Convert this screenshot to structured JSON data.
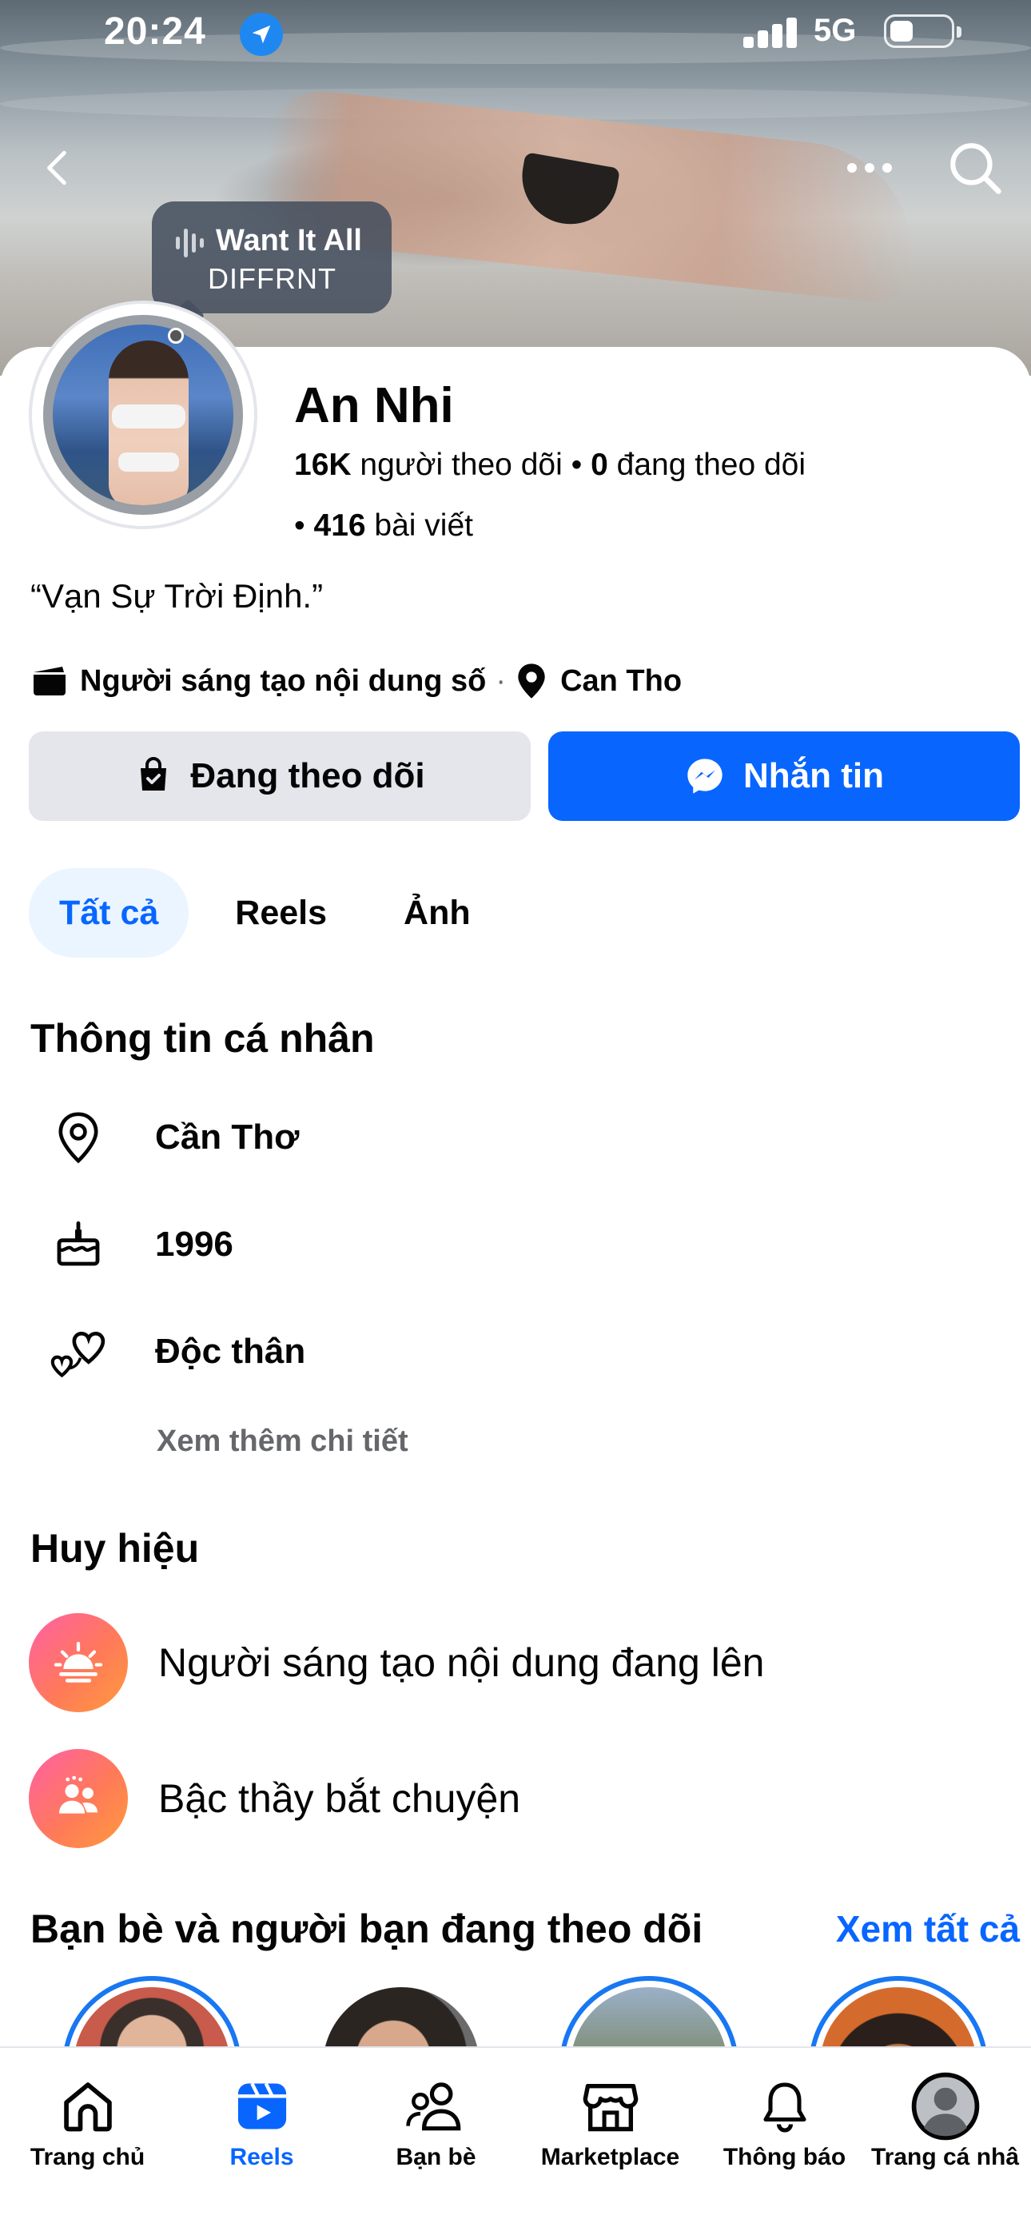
{
  "status_bar": {
    "time": "20:24",
    "network": "5G"
  },
  "music": {
    "title": "Want It All",
    "artist": "DIFFRNT"
  },
  "profile": {
    "name": "An Nhi",
    "followers_count": "16K",
    "followers_label": "người theo dõi",
    "following_count": "0",
    "following_label": "đang theo dõi",
    "posts_count": "416",
    "posts_label": "bài viết",
    "bio": "“Vạn Sự Trời Định.”",
    "category": "Người sáng tạo nội dung số",
    "location": "Can Tho"
  },
  "actions": {
    "follow_label": "Đang theo dõi",
    "message_label": "Nhắn tin"
  },
  "tabs": [
    {
      "label": "Tất cả",
      "active": true
    },
    {
      "label": "Reels",
      "active": false
    },
    {
      "label": "Ảnh",
      "active": false
    }
  ],
  "personal_info": {
    "title": "Thông tin cá nhân",
    "items": [
      {
        "icon": "location-pin-icon",
        "text": "Cần Thơ"
      },
      {
        "icon": "birthday-cake-icon",
        "text": "1996"
      },
      {
        "icon": "relationship-hearts-icon",
        "text": "Độc thân"
      }
    ],
    "see_more": "Xem thêm chi tiết"
  },
  "badges": {
    "title": "Huy hiệu",
    "items": [
      {
        "icon": "rising-sun-icon",
        "text": "Người sáng tạo nội dung đang lên"
      },
      {
        "icon": "people-group-icon",
        "text": "Bậc thầy bắt chuyện"
      }
    ]
  },
  "friends": {
    "title": "Bạn bè và người bạn đang theo dõi",
    "see_all": "Xem tất cả"
  },
  "bottom_nav": [
    {
      "label": "Trang chủ",
      "icon": "home-icon",
      "active": false
    },
    {
      "label": "Reels",
      "icon": "reels-icon",
      "active": true
    },
    {
      "label": "Bạn bè",
      "icon": "friends-icon",
      "active": false
    },
    {
      "label": "Marketplace",
      "icon": "marketplace-icon",
      "active": false
    },
    {
      "label": "Thông báo",
      "icon": "bell-icon",
      "active": false
    },
    {
      "label": "Trang cá nhâ",
      "icon": "profile-icon",
      "active": false
    }
  ],
  "colors": {
    "accent": "#0866ff",
    "secondary_button": "#e4e6eb",
    "muted_text": "#65676b",
    "badge_gradient_start": "#ff5fa6",
    "badge_gradient_end": "#ff9a3c"
  }
}
